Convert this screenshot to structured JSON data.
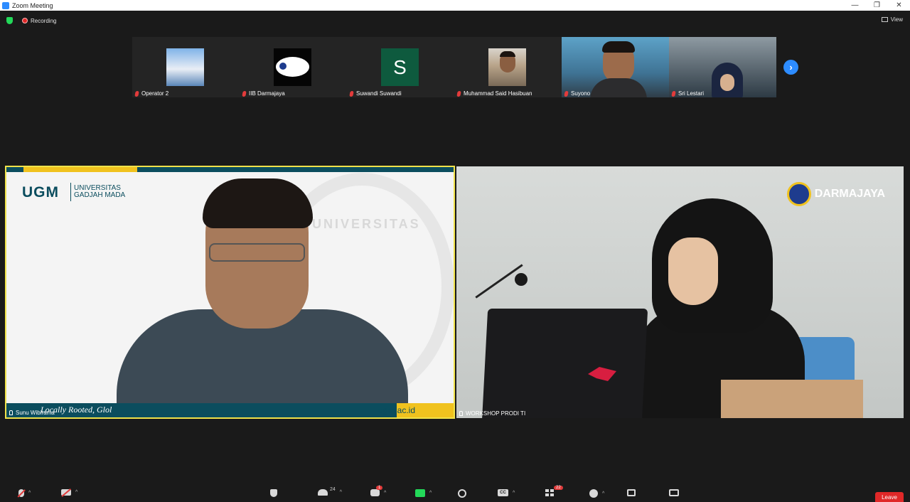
{
  "window": {
    "title": "Zoom Meeting",
    "controls": [
      "—",
      "❐",
      "✕"
    ]
  },
  "topbar": {
    "recording_label": "Recording",
    "view_label": "View"
  },
  "thumbnails": [
    {
      "name": "Operator 2",
      "muted": true
    },
    {
      "name": "IIB Darmajaya",
      "muted": true
    },
    {
      "name": "Suwandi Suwandi",
      "muted": true,
      "avatar_letter": "S"
    },
    {
      "name": "Muhammad Said Hasibuan",
      "muted": true
    },
    {
      "name": "Suyono",
      "muted": true
    },
    {
      "name": "Sri Lestari",
      "muted": true
    }
  ],
  "next_page_icon": "›",
  "main": {
    "left": {
      "name": "Sunu Wibirama",
      "brand": "UGM",
      "brand_sub_1": "UNIVERSITAS",
      "brand_sub_2": "GADJAH MADA",
      "seal_text": "UNIVERSITAS",
      "motto": "Locally Rooted, Glol",
      "site": "ugm.ac.id"
    },
    "right": {
      "name": "WORKSHOP PRODI TI",
      "logo_text": "DARMAJAYA"
    }
  },
  "toolbar": {
    "participants_count": "24",
    "chat_badge": "1",
    "gallery_badge": "22",
    "cc_label": "CC",
    "leave_label": "Leave"
  },
  "colors": {
    "background": "#1a1a1a",
    "active_speaker_border": "#f0e24a",
    "accent": "#2d8cff",
    "leave": "#e02828",
    "share": "#23d959"
  }
}
